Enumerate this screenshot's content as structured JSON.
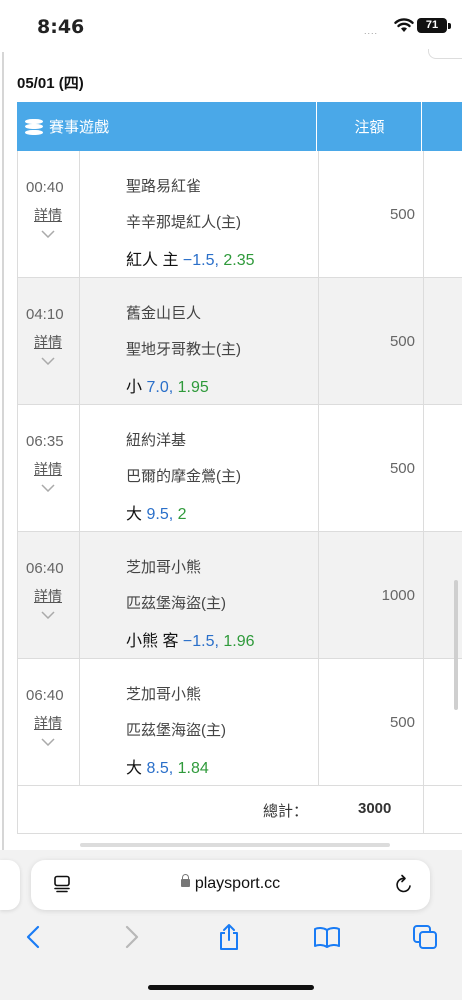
{
  "status_bar": {
    "time": "8:46",
    "signal": "....",
    "battery": "71"
  },
  "date_header": "05/01 (四)",
  "table": {
    "headers": {
      "game": "賽事遊戲",
      "amount": "注額"
    },
    "detail_label": "詳情",
    "rows": [
      {
        "time": "00:40",
        "team_away": "聖路易紅雀",
        "team_home": "辛辛那堤紅人(主)",
        "pick": "紅人 主",
        "line": "−1.5,",
        "odds": "2.35",
        "amount": "500"
      },
      {
        "time": "04:10",
        "team_away": "舊金山巨人",
        "team_home": "聖地牙哥教士(主)",
        "pick": "小",
        "line": "7.0,",
        "odds": "1.95",
        "amount": "500"
      },
      {
        "time": "06:35",
        "team_away": "紐約洋基",
        "team_home": "巴爾的摩金鶯(主)",
        "pick": "大",
        "line": "9.5,",
        "odds": "2",
        "amount": "500"
      },
      {
        "time": "06:40",
        "team_away": "芝加哥小熊",
        "team_home": "匹茲堡海盜(主)",
        "pick": "小熊 客",
        "line": "−1.5,",
        "odds": "1.96",
        "amount": "1000"
      },
      {
        "time": "06:40",
        "team_away": "芝加哥小熊",
        "team_home": "匹茲堡海盜(主)",
        "pick": "大",
        "line": "8.5,",
        "odds": "1.84",
        "amount": "500"
      }
    ],
    "total_label": "總計：",
    "total_value": "3000"
  },
  "browser": {
    "url": "playsport.cc"
  },
  "colors": {
    "header_bg": "#4aa8e8",
    "line_blue": "#2a6fc9",
    "odds_green": "#2f9a3b",
    "ios_blue": "#1a7cf5"
  }
}
